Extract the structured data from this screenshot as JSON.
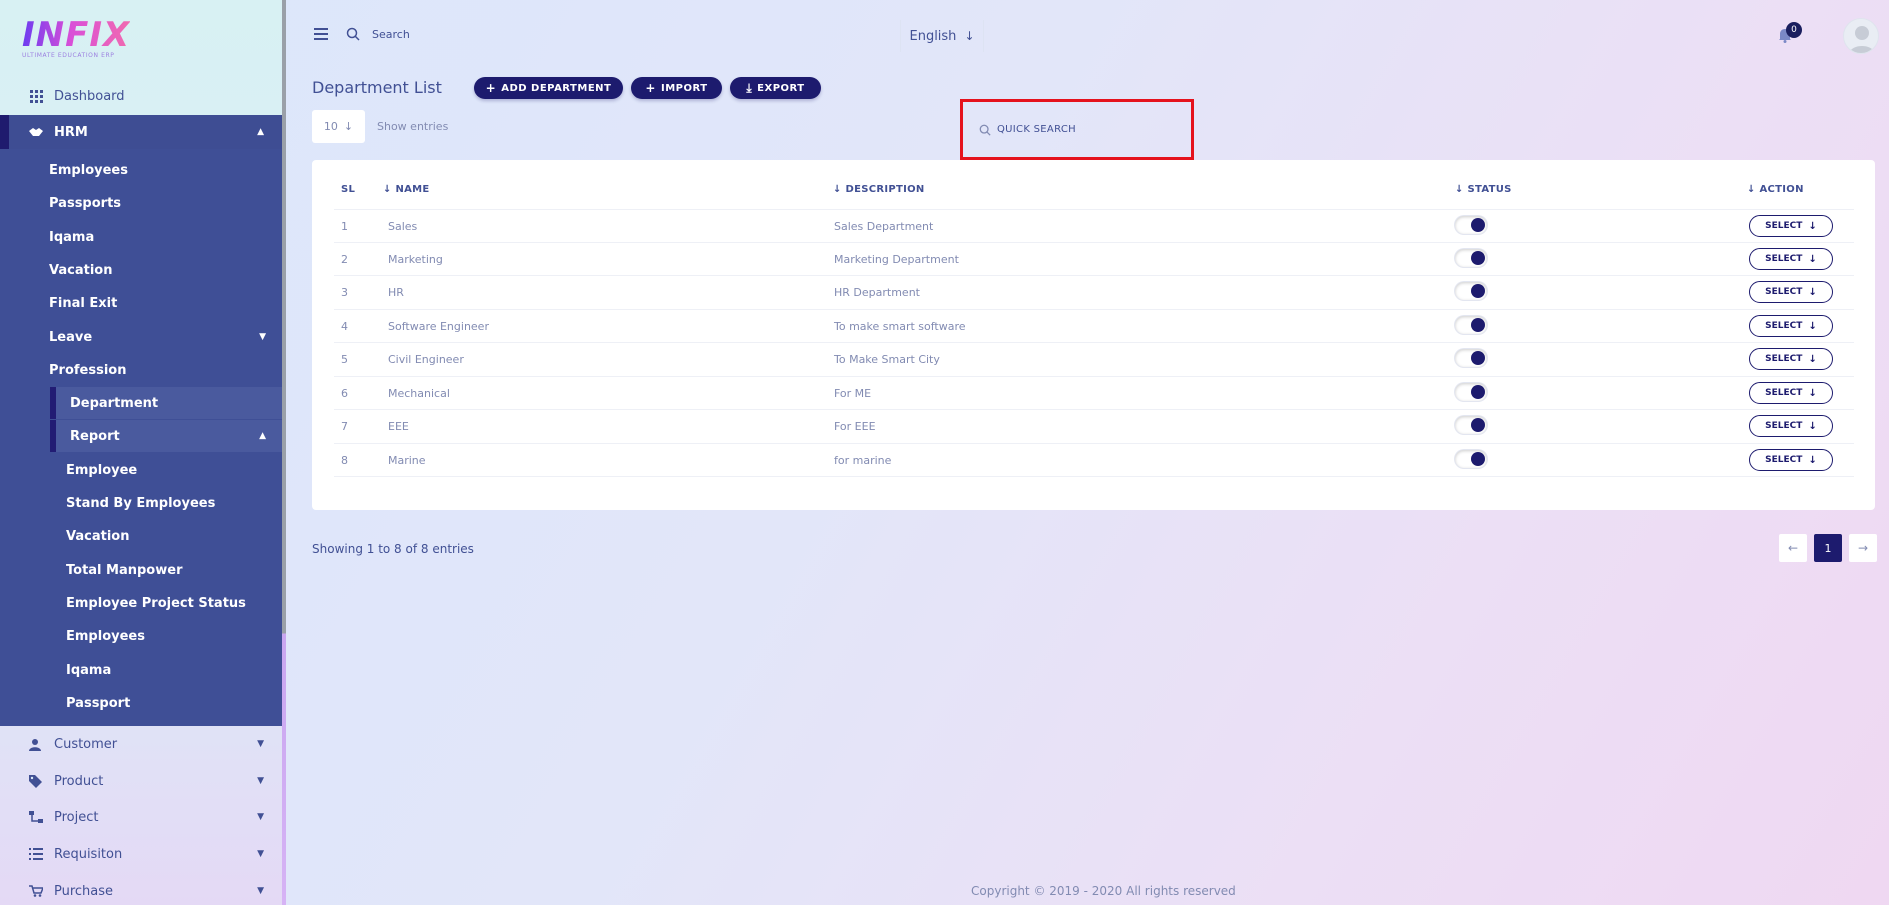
{
  "brand": {
    "logo_text": "INFIX",
    "tagline": "ULTIMATE EDUCATION ERP"
  },
  "topbar": {
    "search_placeholder": "Search",
    "language": "English",
    "notifications_count": "0"
  },
  "sidebar": {
    "dashboard": "Dashboard",
    "hrm": "HRM",
    "hrm_items": [
      "Employees",
      "Passports",
      "Iqama",
      "Vacation",
      "Final Exit",
      "Leave",
      "Profession"
    ],
    "department": "Department",
    "report": "Report",
    "report_items": [
      "Employee",
      "Stand By Employees",
      "Vacation",
      "Total Manpower",
      "Employee Project Status",
      "Employees",
      "Iqama",
      "Passport"
    ],
    "bottom_items": [
      "Customer",
      "Product",
      "Project",
      "Requisiton",
      "Purchase"
    ]
  },
  "page": {
    "title": "Department List",
    "buttons": {
      "add": "ADD DEPARTMENT",
      "import": "IMPORT",
      "export": "EXPORT"
    },
    "entries_value": "10",
    "show_entries": "Show entries",
    "quick_search_placeholder": "QUICK SEARCH"
  },
  "table": {
    "headers": {
      "sl": "SL",
      "name": "NAME",
      "description": "DESCRIPTION",
      "status": "STATUS",
      "action": "ACTION"
    },
    "rows": [
      {
        "sl": "1",
        "name": "Sales",
        "description": "Sales Department",
        "action": "SELECT"
      },
      {
        "sl": "2",
        "name": "Marketing",
        "description": "Marketing Department",
        "action": "SELECT"
      },
      {
        "sl": "3",
        "name": "HR",
        "description": "HR Department",
        "action": "SELECT"
      },
      {
        "sl": "4",
        "name": "Software Engineer",
        "description": "To make smart software",
        "action": "SELECT"
      },
      {
        "sl": "5",
        "name": "Civil Engineer",
        "description": "To Make Smart City",
        "action": "SELECT"
      },
      {
        "sl": "6",
        "name": "Mechanical",
        "description": "For ME",
        "action": "SELECT"
      },
      {
        "sl": "7",
        "name": "EEE",
        "description": "For EEE",
        "action": "SELECT"
      },
      {
        "sl": "8",
        "name": "Marine",
        "description": "for marine",
        "action": "SELECT"
      }
    ]
  },
  "pagination": {
    "showing": "Showing 1 to 8 of 8 entries",
    "current": "1"
  },
  "footer": {
    "copyright": "Copyright © 2019 - 2020 All rights reserved"
  },
  "colors": {
    "primary": "#1d1b6e",
    "sidebar_active": "#3f4f96",
    "text": "#415094",
    "muted": "#828bb2",
    "highlight": "#e5121d"
  }
}
